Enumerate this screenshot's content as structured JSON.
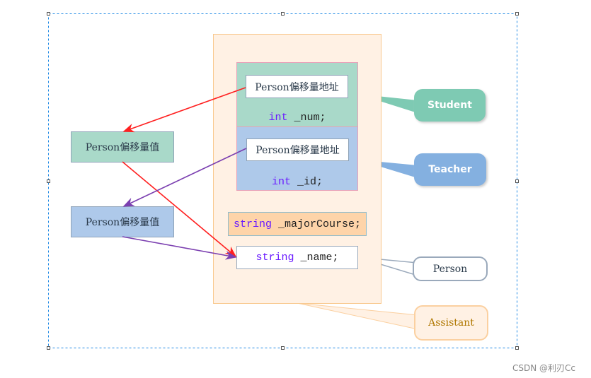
{
  "container": {
    "label": "Assistant"
  },
  "student": {
    "offset_label": "Person偏移量地址",
    "field_type": "int",
    "field_name": " _num;",
    "callout": "Student",
    "color": "#a9d9c9"
  },
  "teacher": {
    "offset_label": "Person偏移量地址",
    "field_type": "int",
    "field_name": " _id;",
    "callout": "Teacher",
    "color": "#aec9ea"
  },
  "assistant": {
    "field_type": "string",
    "field_name": " _majorCourse;"
  },
  "person": {
    "field_type": "string",
    "field_name": " _name;",
    "callout": "Person"
  },
  "left_boxes": [
    {
      "label": "Person偏移量值",
      "color": "#a9d9c9"
    },
    {
      "label": "Person偏移量值",
      "color": "#aec9ea"
    }
  ],
  "arrow_colors": {
    "student": "#ff2020",
    "teacher": "#7b3fb0"
  },
  "watermark": "CSDN @利刃Cc"
}
